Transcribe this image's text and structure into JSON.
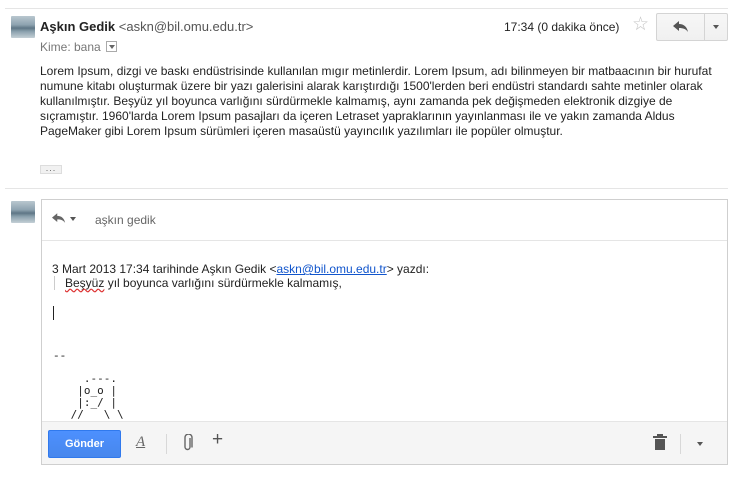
{
  "message": {
    "sender_name": "Aşkın Gedik",
    "sender_email": "<askn@bil.omu.edu.tr>",
    "recipient_line": "Kime: bana",
    "time": "17:34 (0 dakika önce)",
    "body": "Lorem Ipsum, dizgi ve baskı endüstrisinde kullanılan mıgır metinlerdir. Lorem Ipsum, adı bilinmeyen bir matbaacının bir hurufat numune kitabı oluşturmak üzere bir yazı galerisini alarak karıştırdığı 1500'lerden beri endüstri standardı sahte metinler olarak kullanılmıştır. Beşyüz yıl boyunca varlığını sürdürmekle kalmamış, aynı zamanda pek değişmeden elektronik dizgiye de sıçramıştır. 1960'larda Lorem Ipsum pasajları da içeren Letraset yapraklarının yayınlanması ile ve yakın zamanda Aldus PageMaker gibi Lorem Ipsum sürümleri içeren masaüstü yayıncılık yazılımları ile popüler olmuştur.",
    "trimmed_label": "...",
    "icons": {
      "star": "star-icon",
      "reply": "reply-icon",
      "more": "chevron-down-icon"
    }
  },
  "compose": {
    "recipient": "aşkın gedik",
    "quote_intro_before": "3 Mart 2013 17:34 tarihinde Aşkın Gedik <",
    "quote_link": "askn@bil.omu.edu.tr",
    "quote_intro_after": "> yazdı:",
    "quoted_word1": "Beşyüz",
    "quoted_rest": " yıl boyunca varlığını sürdürmekle ",
    "quoted_word2": "kalmamış",
    "quoted_end": ",",
    "signature_separator": "--",
    "signature_art": "   .---.\n  |o_o |\n  |:_/ |\n //   \\ \\",
    "send_label": "Gönder",
    "format_label": "A",
    "insert_label": "+",
    "icons": {
      "reply_type": "reply-icon",
      "attach": "paperclip-icon",
      "trash": "trash-icon",
      "more_options": "chevron-down-icon"
    }
  },
  "colors": {
    "send_button": "#4d90fe",
    "link": "#1155cc"
  }
}
